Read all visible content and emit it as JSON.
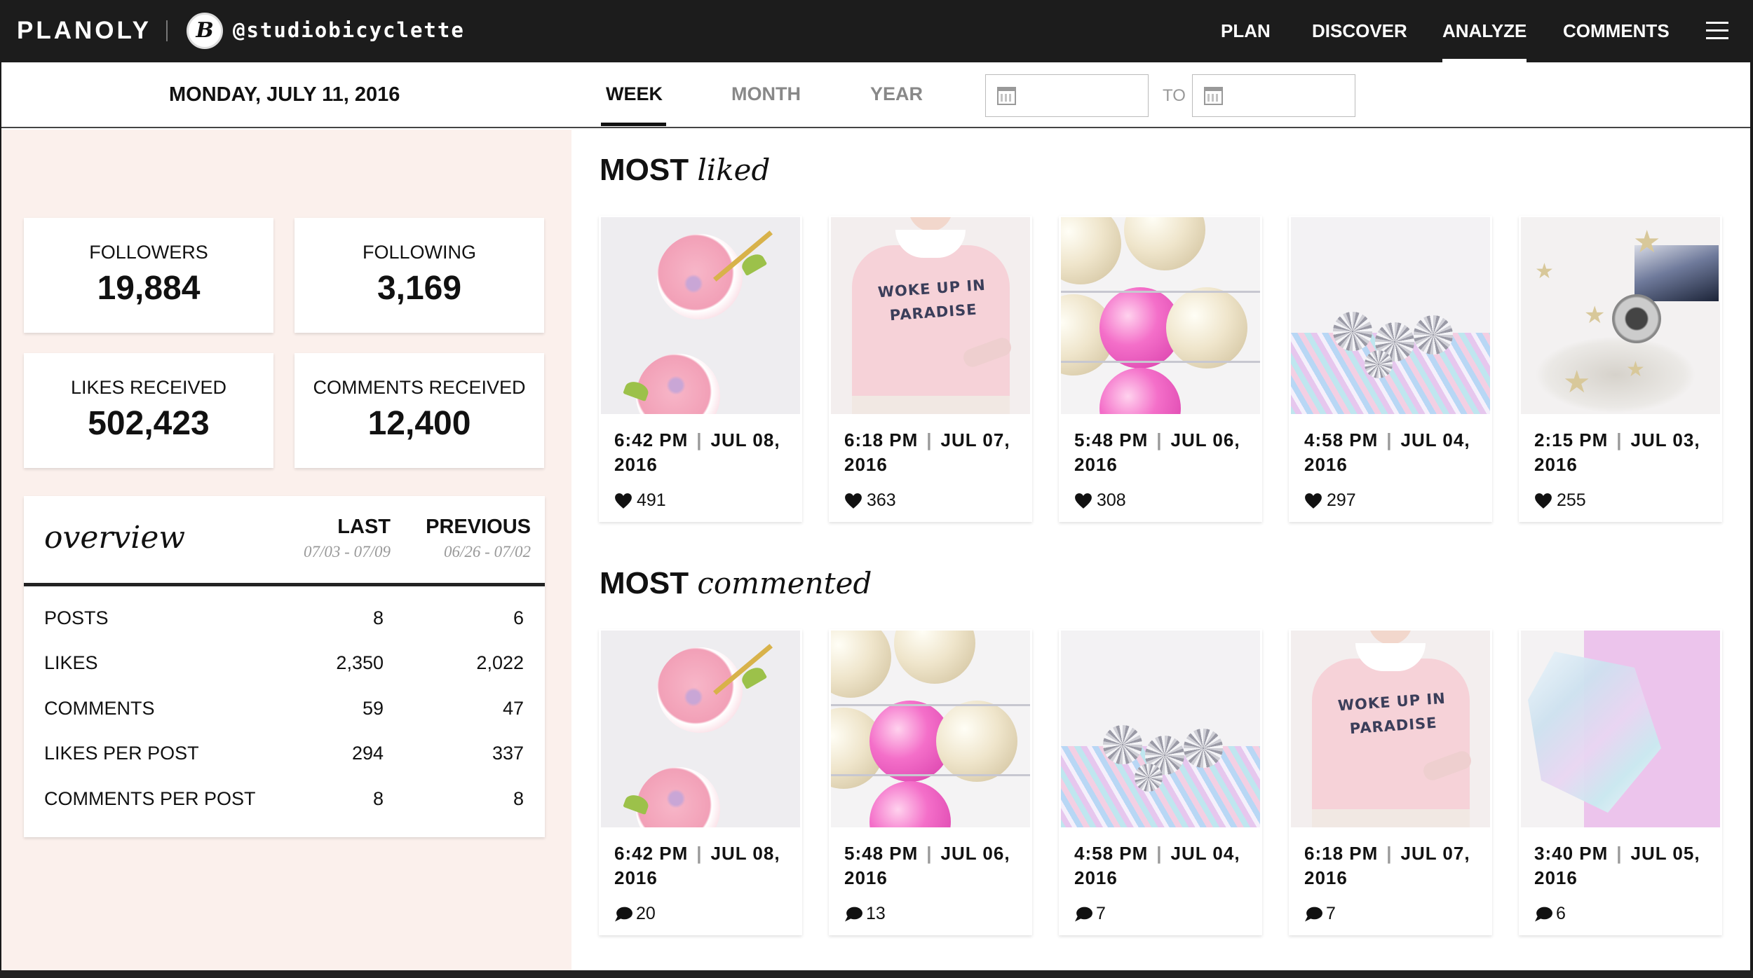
{
  "app": {
    "logo": "PLANOLY",
    "avatar_letter": "B",
    "handle": "@studiobicyclette"
  },
  "nav": {
    "items": [
      {
        "label": "PLAN"
      },
      {
        "label": "DISCOVER"
      },
      {
        "label": "ANALYZE",
        "active": true
      },
      {
        "label": "COMMENTS"
      }
    ]
  },
  "filter": {
    "date": "MONDAY, JULY 11, 2016",
    "tabs": [
      {
        "label": "WEEK",
        "active": true
      },
      {
        "label": "MONTH"
      },
      {
        "label": "YEAR"
      }
    ],
    "to_label": "TO",
    "from_value": "",
    "to_value": ""
  },
  "stats": [
    {
      "label": "FOLLOWERS",
      "value": "19,884"
    },
    {
      "label": "FOLLOWING",
      "value": "3,169"
    },
    {
      "label": "LIKES RECEIVED",
      "value": "502,423"
    },
    {
      "label": "COMMENTS RECEIVED",
      "value": "12,400"
    }
  ],
  "overview": {
    "title": "overview",
    "last_label": "LAST",
    "last_range": "07/03 - 07/09",
    "previous_label": "PREVIOUS",
    "previous_range": "06/26 - 07/02",
    "rows": [
      {
        "label": "POSTS",
        "last": "8",
        "previous": "6"
      },
      {
        "label": "LIKES",
        "last": "2,350",
        "previous": "2,022"
      },
      {
        "label": "COMMENTS",
        "last": "59",
        "previous": "47"
      },
      {
        "label": "LIKES PER POST",
        "last": "294",
        "previous": "337"
      },
      {
        "label": "COMMENTS PER POST",
        "last": "8",
        "previous": "8"
      }
    ]
  },
  "most_liked": {
    "title_bold": "MOST",
    "title_italic": "liked",
    "posts": [
      {
        "time": "6:42 PM",
        "date": "JUL 08,",
        "year": "2016",
        "count": "491",
        "photo": "drinks"
      },
      {
        "time": "6:18 PM",
        "date": "JUL 07,",
        "year": "2016",
        "count": "363",
        "photo": "sweater"
      },
      {
        "time": "5:48 PM",
        "date": "JUL 06,",
        "year": "2016",
        "count": "308",
        "photo": "balloons"
      },
      {
        "time": "4:58 PM",
        "date": "JUL 04,",
        "year": "2016",
        "count": "297",
        "photo": "disco"
      },
      {
        "time": "2:15 PM",
        "date": "JUL 03,",
        "year": "2016",
        "count": "255",
        "photo": "stars"
      }
    ]
  },
  "most_commented": {
    "title_bold": "MOST",
    "title_italic": "commented",
    "posts": [
      {
        "time": "6:42 PM",
        "date": "JUL 08,",
        "year": "2016",
        "count": "20",
        "photo": "drinks"
      },
      {
        "time": "5:48 PM",
        "date": "JUL 06,",
        "year": "2016",
        "count": "13",
        "photo": "balloons"
      },
      {
        "time": "4:58 PM",
        "date": "JUL 04,",
        "year": "2016",
        "count": "7",
        "photo": "disco"
      },
      {
        "time": "6:18 PM",
        "date": "JUL 07,",
        "year": "2016",
        "count": "7",
        "photo": "sweater"
      },
      {
        "time": "3:40 PM",
        "date": "JUL 05,",
        "year": "2016",
        "count": "6",
        "photo": "holo"
      }
    ]
  },
  "photo_text": {
    "sweater": [
      "WOKE UP IN",
      "PARADISE"
    ]
  }
}
